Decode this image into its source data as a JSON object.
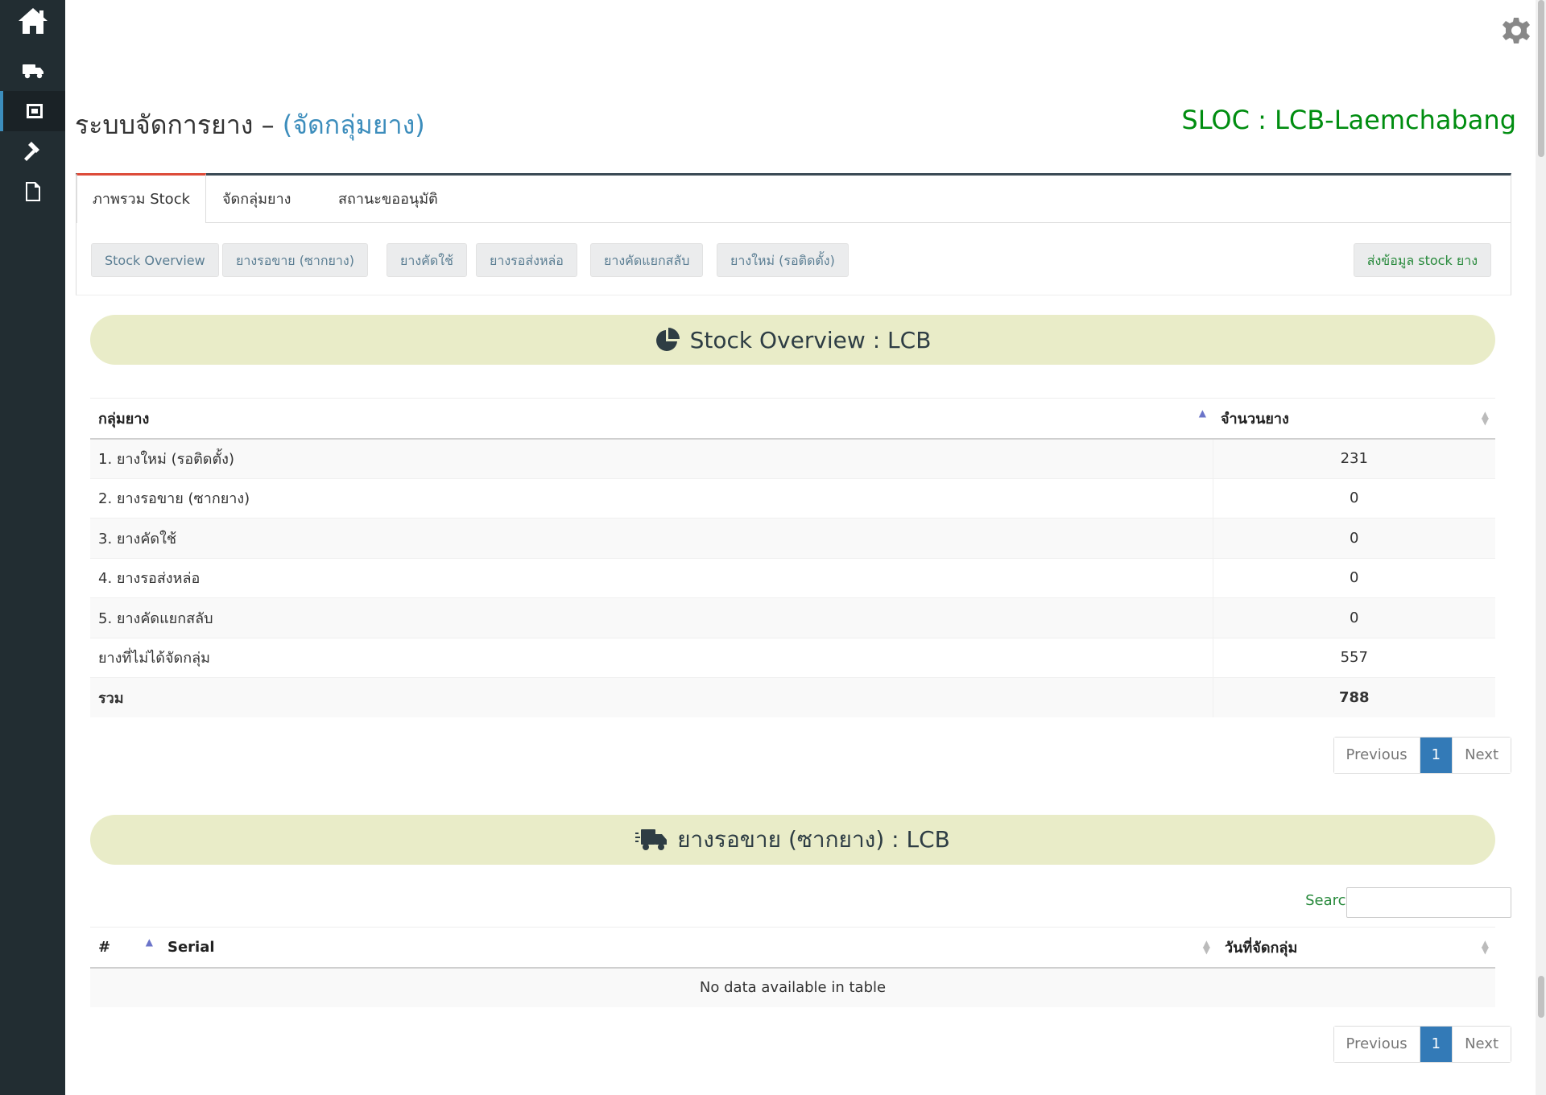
{
  "sidebar": {
    "items": [
      {
        "icon": "home-icon"
      },
      {
        "icon": "truck-icon"
      },
      {
        "icon": "tire-group-icon"
      },
      {
        "icon": "gavel-icon"
      },
      {
        "icon": "file-icon"
      }
    ],
    "active_index": 2
  },
  "header": {
    "title": "ระบบจัดการยาง – ",
    "subtitle": "(จัดกลุ่มยาง)",
    "sloc": "SLOC : LCB-Laemchabang",
    "settings_icon": "gear-icon"
  },
  "tabs": [
    {
      "label": "ภาพรวม Stock",
      "active": true
    },
    {
      "label": "จัดกลุ่มยาง",
      "active": false
    },
    {
      "label": "สถานะขออนุมัติ",
      "active": false
    }
  ],
  "sub_buttons": [
    {
      "label": "Stock Overview"
    },
    {
      "label": "ยางรอขาย (ซากยาง)"
    },
    {
      "label": "ยางคัดใช้"
    },
    {
      "label": "ยางรอส่งหล่อ"
    },
    {
      "label": "ยางคัดแยกสลับ"
    },
    {
      "label": "ยางใหม่ (รอติดตั้ง)"
    }
  ],
  "send_button": "ส่งข้อมูล stock ยาง",
  "overview": {
    "banner": "Stock Overview : LCB",
    "columns": [
      "กลุ่มยาง",
      "จำนวนยาง"
    ],
    "rows": [
      {
        "group": "1. ยางใหม่ (รอติดตั้ง)",
        "count": "231"
      },
      {
        "group": "2. ยางรอขาย (ซากยาง)",
        "count": "0"
      },
      {
        "group": "3. ยางคัดใช้",
        "count": "0"
      },
      {
        "group": "4. ยางรอส่งหล่อ",
        "count": "0"
      },
      {
        "group": "5. ยางคัดแยกสลับ",
        "count": "0"
      },
      {
        "group": "ยางที่ไม่ได้จัดกลุ่ม",
        "count": "557"
      },
      {
        "group": "รวม",
        "count": "788"
      }
    ],
    "pager": {
      "prev": "Previous",
      "page": "1",
      "next": "Next"
    }
  },
  "salvage": {
    "banner": "ยางรอขาย (ซากยาง) : LCB",
    "search_label": "Search:",
    "search_value": "",
    "columns": [
      "#",
      "Serial",
      "วันที่จัดกลุ่ม"
    ],
    "empty_text": "No data available in table",
    "pager": {
      "prev": "Previous",
      "page": "1",
      "next": "Next"
    }
  }
}
